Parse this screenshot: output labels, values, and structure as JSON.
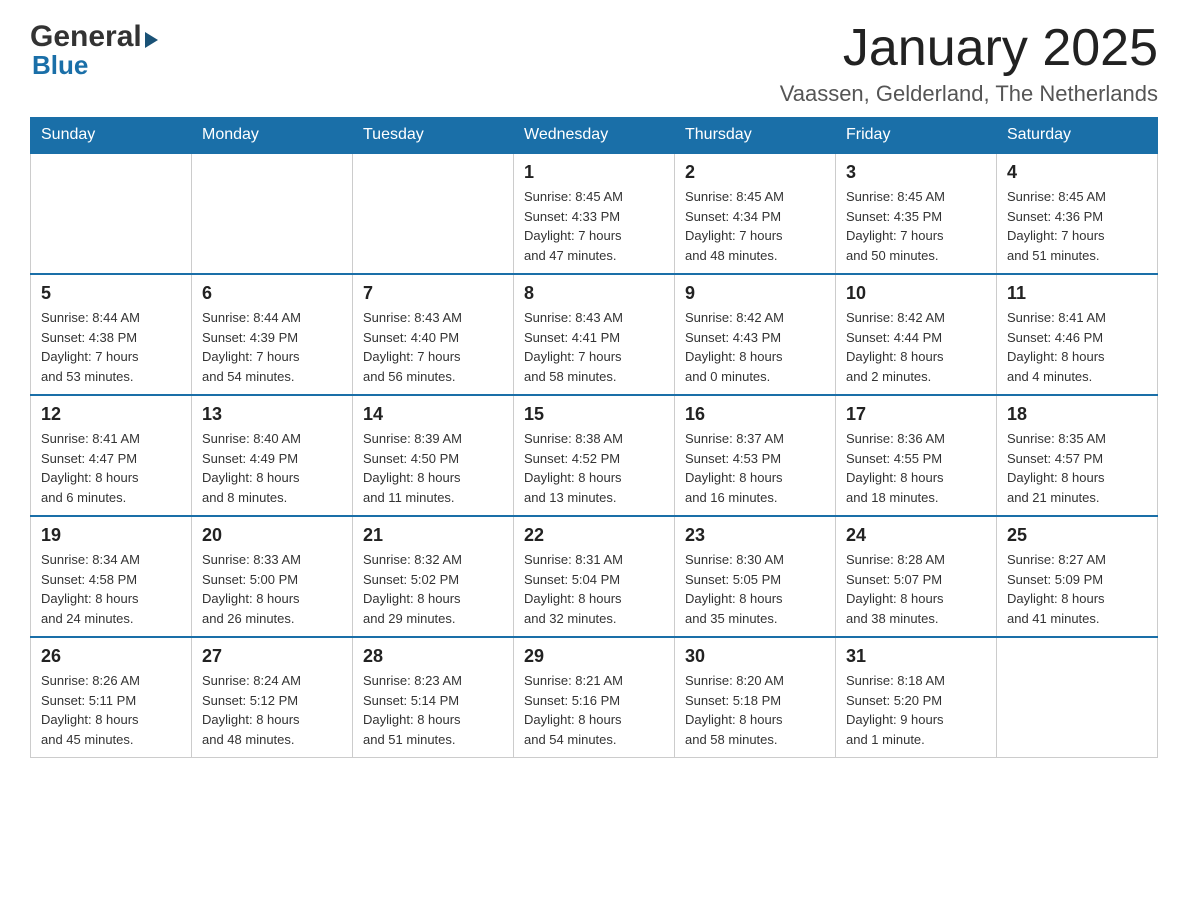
{
  "header": {
    "logo_general": "General",
    "logo_blue": "Blue",
    "title": "January 2025",
    "subtitle": "Vaassen, Gelderland, The Netherlands"
  },
  "weekdays": [
    "Sunday",
    "Monday",
    "Tuesday",
    "Wednesday",
    "Thursday",
    "Friday",
    "Saturday"
  ],
  "weeks": [
    [
      {
        "day": "",
        "info": ""
      },
      {
        "day": "",
        "info": ""
      },
      {
        "day": "",
        "info": ""
      },
      {
        "day": "1",
        "info": "Sunrise: 8:45 AM\nSunset: 4:33 PM\nDaylight: 7 hours\nand 47 minutes."
      },
      {
        "day": "2",
        "info": "Sunrise: 8:45 AM\nSunset: 4:34 PM\nDaylight: 7 hours\nand 48 minutes."
      },
      {
        "day": "3",
        "info": "Sunrise: 8:45 AM\nSunset: 4:35 PM\nDaylight: 7 hours\nand 50 minutes."
      },
      {
        "day": "4",
        "info": "Sunrise: 8:45 AM\nSunset: 4:36 PM\nDaylight: 7 hours\nand 51 minutes."
      }
    ],
    [
      {
        "day": "5",
        "info": "Sunrise: 8:44 AM\nSunset: 4:38 PM\nDaylight: 7 hours\nand 53 minutes."
      },
      {
        "day": "6",
        "info": "Sunrise: 8:44 AM\nSunset: 4:39 PM\nDaylight: 7 hours\nand 54 minutes."
      },
      {
        "day": "7",
        "info": "Sunrise: 8:43 AM\nSunset: 4:40 PM\nDaylight: 7 hours\nand 56 minutes."
      },
      {
        "day": "8",
        "info": "Sunrise: 8:43 AM\nSunset: 4:41 PM\nDaylight: 7 hours\nand 58 minutes."
      },
      {
        "day": "9",
        "info": "Sunrise: 8:42 AM\nSunset: 4:43 PM\nDaylight: 8 hours\nand 0 minutes."
      },
      {
        "day": "10",
        "info": "Sunrise: 8:42 AM\nSunset: 4:44 PM\nDaylight: 8 hours\nand 2 minutes."
      },
      {
        "day": "11",
        "info": "Sunrise: 8:41 AM\nSunset: 4:46 PM\nDaylight: 8 hours\nand 4 minutes."
      }
    ],
    [
      {
        "day": "12",
        "info": "Sunrise: 8:41 AM\nSunset: 4:47 PM\nDaylight: 8 hours\nand 6 minutes."
      },
      {
        "day": "13",
        "info": "Sunrise: 8:40 AM\nSunset: 4:49 PM\nDaylight: 8 hours\nand 8 minutes."
      },
      {
        "day": "14",
        "info": "Sunrise: 8:39 AM\nSunset: 4:50 PM\nDaylight: 8 hours\nand 11 minutes."
      },
      {
        "day": "15",
        "info": "Sunrise: 8:38 AM\nSunset: 4:52 PM\nDaylight: 8 hours\nand 13 minutes."
      },
      {
        "day": "16",
        "info": "Sunrise: 8:37 AM\nSunset: 4:53 PM\nDaylight: 8 hours\nand 16 minutes."
      },
      {
        "day": "17",
        "info": "Sunrise: 8:36 AM\nSunset: 4:55 PM\nDaylight: 8 hours\nand 18 minutes."
      },
      {
        "day": "18",
        "info": "Sunrise: 8:35 AM\nSunset: 4:57 PM\nDaylight: 8 hours\nand 21 minutes."
      }
    ],
    [
      {
        "day": "19",
        "info": "Sunrise: 8:34 AM\nSunset: 4:58 PM\nDaylight: 8 hours\nand 24 minutes."
      },
      {
        "day": "20",
        "info": "Sunrise: 8:33 AM\nSunset: 5:00 PM\nDaylight: 8 hours\nand 26 minutes."
      },
      {
        "day": "21",
        "info": "Sunrise: 8:32 AM\nSunset: 5:02 PM\nDaylight: 8 hours\nand 29 minutes."
      },
      {
        "day": "22",
        "info": "Sunrise: 8:31 AM\nSunset: 5:04 PM\nDaylight: 8 hours\nand 32 minutes."
      },
      {
        "day": "23",
        "info": "Sunrise: 8:30 AM\nSunset: 5:05 PM\nDaylight: 8 hours\nand 35 minutes."
      },
      {
        "day": "24",
        "info": "Sunrise: 8:28 AM\nSunset: 5:07 PM\nDaylight: 8 hours\nand 38 minutes."
      },
      {
        "day": "25",
        "info": "Sunrise: 8:27 AM\nSunset: 5:09 PM\nDaylight: 8 hours\nand 41 minutes."
      }
    ],
    [
      {
        "day": "26",
        "info": "Sunrise: 8:26 AM\nSunset: 5:11 PM\nDaylight: 8 hours\nand 45 minutes."
      },
      {
        "day": "27",
        "info": "Sunrise: 8:24 AM\nSunset: 5:12 PM\nDaylight: 8 hours\nand 48 minutes."
      },
      {
        "day": "28",
        "info": "Sunrise: 8:23 AM\nSunset: 5:14 PM\nDaylight: 8 hours\nand 51 minutes."
      },
      {
        "day": "29",
        "info": "Sunrise: 8:21 AM\nSunset: 5:16 PM\nDaylight: 8 hours\nand 54 minutes."
      },
      {
        "day": "30",
        "info": "Sunrise: 8:20 AM\nSunset: 5:18 PM\nDaylight: 8 hours\nand 58 minutes."
      },
      {
        "day": "31",
        "info": "Sunrise: 8:18 AM\nSunset: 5:20 PM\nDaylight: 9 hours\nand 1 minute."
      },
      {
        "day": "",
        "info": ""
      }
    ]
  ]
}
